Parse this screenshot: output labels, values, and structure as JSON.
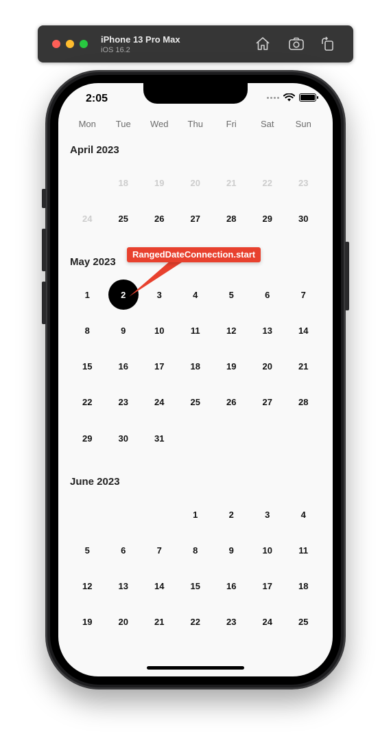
{
  "simulator": {
    "device": "iPhone 13 Pro Max",
    "os": "iOS 16.2"
  },
  "status_bar": {
    "time": "2:05"
  },
  "weekdays": [
    "Mon",
    "Tue",
    "Wed",
    "Thu",
    "Fri",
    "Sat",
    "Sun"
  ],
  "months": [
    {
      "title": "April 2023",
      "rows": [
        [
          {
            "d": ""
          },
          {
            "d": "18",
            "muted": true
          },
          {
            "d": "19",
            "muted": true
          },
          {
            "d": "20",
            "muted": true
          },
          {
            "d": "21",
            "muted": true
          },
          {
            "d": "22",
            "muted": true
          },
          {
            "d": "23",
            "muted": true
          }
        ],
        [
          {
            "d": "24",
            "muted": true
          },
          {
            "d": "25"
          },
          {
            "d": "26"
          },
          {
            "d": "27"
          },
          {
            "d": "28"
          },
          {
            "d": "29"
          },
          {
            "d": "30"
          }
        ]
      ]
    },
    {
      "title": "May 2023",
      "rows": [
        [
          {
            "d": "1"
          },
          {
            "d": "2",
            "selected": true
          },
          {
            "d": "3"
          },
          {
            "d": "4"
          },
          {
            "d": "5"
          },
          {
            "d": "6"
          },
          {
            "d": "7"
          }
        ],
        [
          {
            "d": "8"
          },
          {
            "d": "9"
          },
          {
            "d": "10"
          },
          {
            "d": "11"
          },
          {
            "d": "12"
          },
          {
            "d": "13"
          },
          {
            "d": "14"
          }
        ],
        [
          {
            "d": "15"
          },
          {
            "d": "16"
          },
          {
            "d": "17"
          },
          {
            "d": "18"
          },
          {
            "d": "19"
          },
          {
            "d": "20"
          },
          {
            "d": "21"
          }
        ],
        [
          {
            "d": "22"
          },
          {
            "d": "23"
          },
          {
            "d": "24"
          },
          {
            "d": "25"
          },
          {
            "d": "26"
          },
          {
            "d": "27"
          },
          {
            "d": "28"
          }
        ],
        [
          {
            "d": "29"
          },
          {
            "d": "30"
          },
          {
            "d": "31"
          },
          {
            "d": ""
          },
          {
            "d": ""
          },
          {
            "d": ""
          },
          {
            "d": ""
          }
        ]
      ]
    },
    {
      "title": "June 2023",
      "rows": [
        [
          {
            "d": ""
          },
          {
            "d": ""
          },
          {
            "d": ""
          },
          {
            "d": "1"
          },
          {
            "d": "2"
          },
          {
            "d": "3"
          },
          {
            "d": "4"
          }
        ],
        [
          {
            "d": "5"
          },
          {
            "d": "6"
          },
          {
            "d": "7"
          },
          {
            "d": "8"
          },
          {
            "d": "9"
          },
          {
            "d": "10"
          },
          {
            "d": "11"
          }
        ],
        [
          {
            "d": "12"
          },
          {
            "d": "13"
          },
          {
            "d": "14"
          },
          {
            "d": "15"
          },
          {
            "d": "16"
          },
          {
            "d": "17"
          },
          {
            "d": "18"
          }
        ],
        [
          {
            "d": "19"
          },
          {
            "d": "20"
          },
          {
            "d": "21"
          },
          {
            "d": "22"
          },
          {
            "d": "23"
          },
          {
            "d": "24"
          },
          {
            "d": "25"
          }
        ]
      ]
    }
  ],
  "annotation": {
    "label": "RangedDateConnection.start"
  },
  "colors": {
    "annotation_bg": "#e8412e",
    "selected_bg": "#000000",
    "muted_day": "#cdcdcd",
    "screen_bg": "#f9f9f9"
  },
  "icons": {
    "toolbar": [
      "home-icon",
      "screenshot-icon",
      "rotate-icon"
    ],
    "status": [
      "signal-dots-icon",
      "wifi-icon",
      "battery-icon"
    ]
  }
}
